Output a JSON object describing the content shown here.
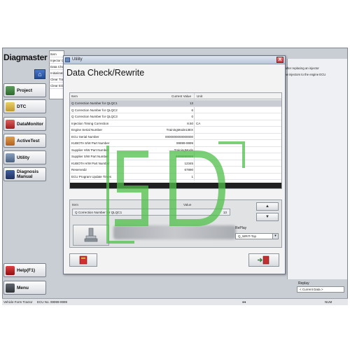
{
  "app": {
    "brand": "Diagmaster",
    "nav": [
      {
        "label": "Project",
        "icon": "project-icon"
      },
      {
        "label": "DTC",
        "icon": "dtc-icon"
      },
      {
        "label": "DataMonitor",
        "icon": "data-monitor-icon"
      },
      {
        "label": "ActiveTest",
        "icon": "active-test-icon"
      },
      {
        "label": "Utility",
        "icon": "utility-icon"
      },
      {
        "label": "Diagnosis Manual",
        "icon": "manual-icon"
      }
    ],
    "help": "Help(F1)",
    "menu": "Menu"
  },
  "items_panel": {
    "header": "Item",
    "rows": [
      "Injector Q",
      "Data Che",
      "Initializati",
      "Clear Tra",
      "Clear EG"
    ]
  },
  "right_panel": {
    "lines": [
      "g after replacing an injector",
      "",
      "new injectors to the engine ECU"
    ],
    "replay_label": "Replay",
    "replay_value": "< Current Data >"
  },
  "statusbar": {
    "vehicle": "Vehicle Form Tractor",
    "ecu": "ECU No. 99999-9999",
    "num": "NUM"
  },
  "dialog": {
    "title": "Utility",
    "heading": "Data Check/Rewrite",
    "columns": {
      "item": "Item",
      "current_value": "Current Value",
      "unit": "Unit"
    },
    "rows": [
      {
        "item": "Q Correction Number for QLQC1",
        "value": "13",
        "unit": "",
        "selected": true
      },
      {
        "item": "Q Correction Number for QLQC2",
        "value": "6",
        "unit": ""
      },
      {
        "item": "Q Correction Number for QLQC3",
        "value": "0",
        "unit": ""
      },
      {
        "item": "Injection Timing Correction",
        "value": "8.50",
        "unit": "CA"
      },
      {
        "item": "Engine Serial Number",
        "value": "TrainingMode13EX",
        "unit": ""
      },
      {
        "item": "ECU Serial Number",
        "value": "0000000000000000",
        "unit": ""
      },
      {
        "item": "KUBOTA S/W Part Number",
        "value": "99999-9999",
        "unit": ""
      },
      {
        "item": "Supplier H/W Part Number",
        "value": "TrainingMode",
        "unit": ""
      },
      {
        "item": "Supplier S/W Part Number",
        "value": "9999999999",
        "unit": ""
      },
      {
        "item": "KUBOTA H/W Part Number",
        "value": "12345",
        "unit": ""
      },
      {
        "item": "Reserved2",
        "value": "67890",
        "unit": ""
      },
      {
        "item": "ECU Program Update Times",
        "value": "1",
        "unit": ""
      }
    ],
    "edit": {
      "item_label": "Item",
      "value_label": "Value",
      "item": "Q Correction Number for QLQC1",
      "value": "13",
      "up": "▲",
      "down": "▼",
      "replay_label": "RePlay",
      "replay_value": "Q_WRIT-Top"
    },
    "close": "X"
  },
  "colors": {
    "selected_row": "#c9ccd2",
    "watermark": "#4fbf4a",
    "frame": "#c9cdd4"
  }
}
